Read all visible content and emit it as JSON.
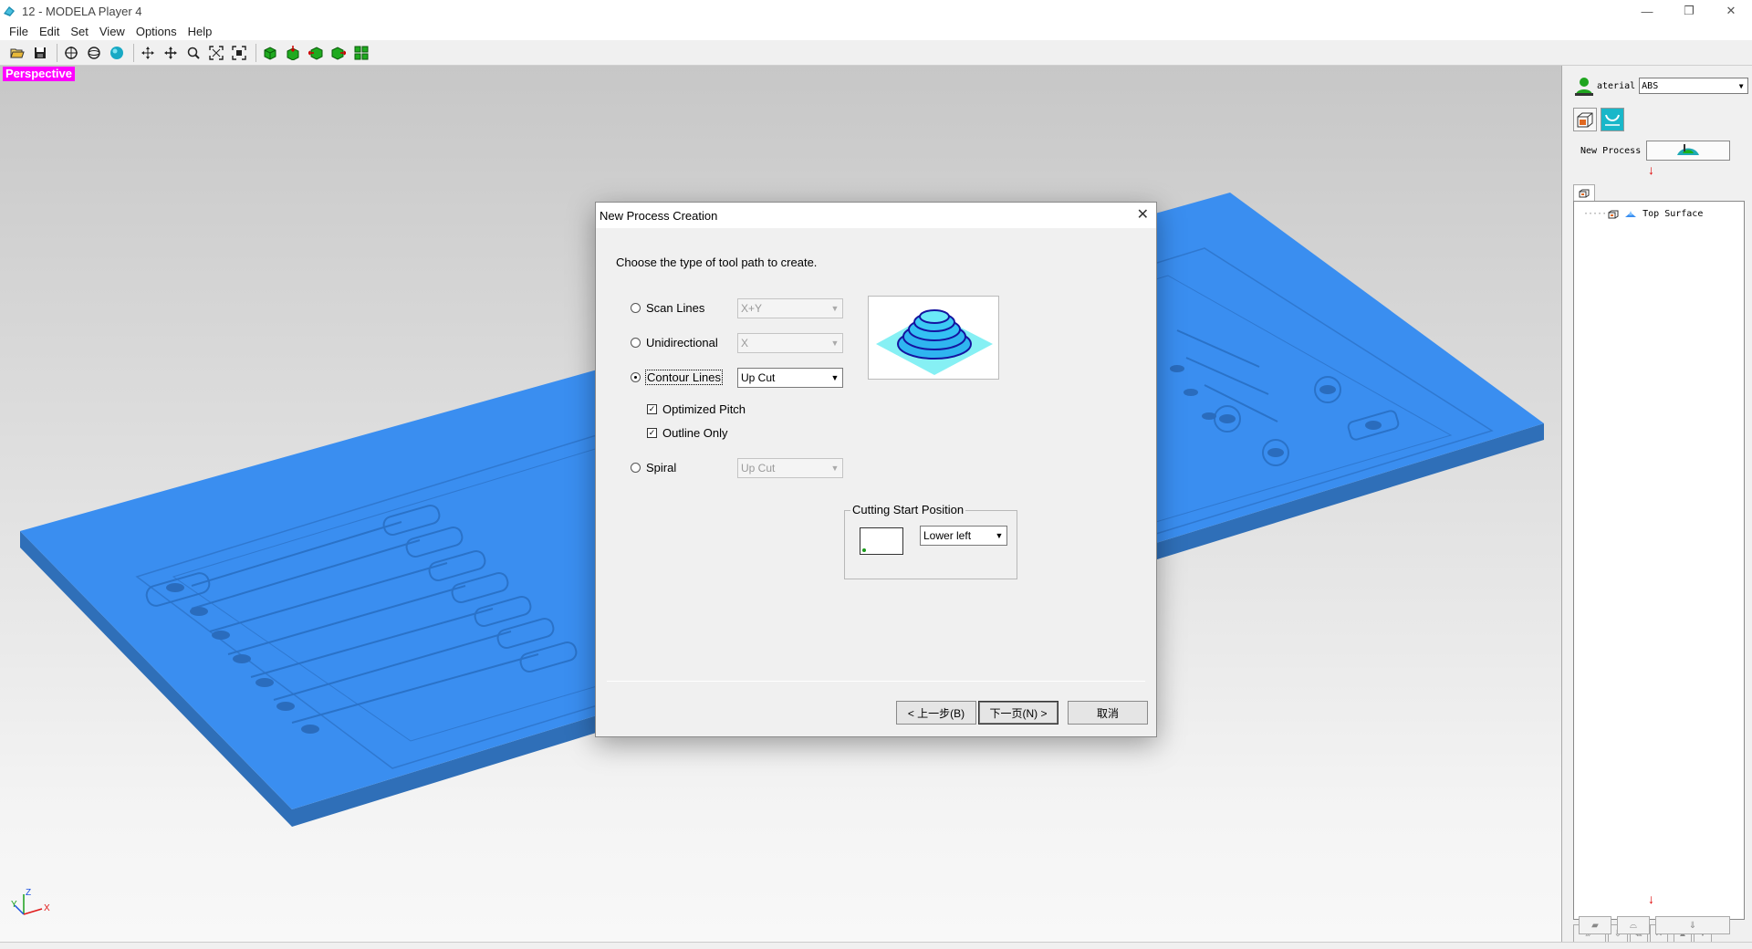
{
  "window": {
    "title": "12 - MODELA Player 4",
    "minimize": "—",
    "restore": "❐",
    "close": "✕"
  },
  "menu": [
    "File",
    "Edit",
    "Set",
    "View",
    "Options",
    "Help"
  ],
  "toolbar": {
    "icons": [
      "open-icon",
      "save-icon",
      "view-front-icon",
      "view-side-icon",
      "render-sphere-icon",
      "pan-icon",
      "move-icon",
      "zoom-icon",
      "zoom-fit-icon",
      "zoom-window-icon",
      "green-box-icon",
      "green-box-down-icon",
      "green-box-left-icon",
      "green-box-right-icon",
      "green-layout-icon"
    ]
  },
  "viewport": {
    "projection_label": "Perspective",
    "axis": {
      "z": "Z",
      "y": "Y",
      "x": "X"
    },
    "model_color": "#3a8ef0"
  },
  "right_panel": {
    "material_label": "aterial",
    "material_value": "ABS",
    "new_process_label": "New Process",
    "tree_items": [
      "Top Surface"
    ]
  },
  "dialog": {
    "title": "New Process Creation",
    "close": "✕",
    "prompt": "Choose the type of tool path to create.",
    "options": [
      {
        "label": "Scan Lines",
        "selected": false,
        "combo": "X+Y",
        "enabled": false
      },
      {
        "label": "Unidirectional",
        "selected": false,
        "combo": "X",
        "enabled": false
      },
      {
        "label": "Contour Lines",
        "selected": true,
        "combo": "Up Cut",
        "enabled": true
      },
      {
        "label": "Spiral",
        "selected": false,
        "combo": "Up Cut",
        "enabled": false
      }
    ],
    "checkboxes": [
      {
        "label": "Optimized Pitch",
        "checked": true
      },
      {
        "label": "Outline Only",
        "checked": true
      }
    ],
    "start_position": {
      "group_title": "Cutting Start Position",
      "value": "Lower left"
    },
    "buttons": {
      "back": "< 上一步(B)",
      "next": "下一页(N) >",
      "cancel": "取消"
    }
  }
}
